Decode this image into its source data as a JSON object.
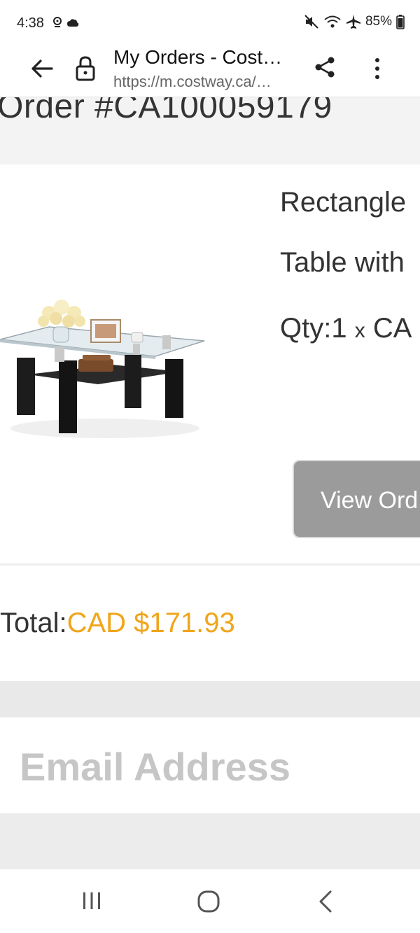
{
  "status_bar": {
    "time": "4:38",
    "battery": "85%",
    "icons": [
      "location-icon",
      "cloud-icon",
      "mute-icon",
      "wifi-icon",
      "airplane-icon",
      "battery-icon"
    ]
  },
  "browser": {
    "title": "My Orders - Cost…",
    "url": "https://m.costway.ca/…",
    "icons": [
      "back-arrow-icon",
      "lock-icon",
      "share-icon",
      "more-vert-icon"
    ]
  },
  "order": {
    "number": "Order #CA100059179",
    "item": {
      "name_line1": "Rectangle",
      "name_line2": "Table with",
      "qty_label": "Qty:1",
      "qty_x": "x",
      "price_partial": "CA",
      "image_alt": "coffee-table-photo",
      "view_button_label": "View Ord"
    },
    "total_label": "Total:",
    "total_amount": "CAD $171.93"
  },
  "email_section": {
    "heading": "Email Address"
  },
  "nav": {
    "icons": [
      "recents-icon",
      "home-icon",
      "back-icon"
    ]
  },
  "colors": {
    "accent_price": "#f0a51a",
    "button_gray": "#9b9b9b",
    "page_gray": "#f1f1f1"
  }
}
